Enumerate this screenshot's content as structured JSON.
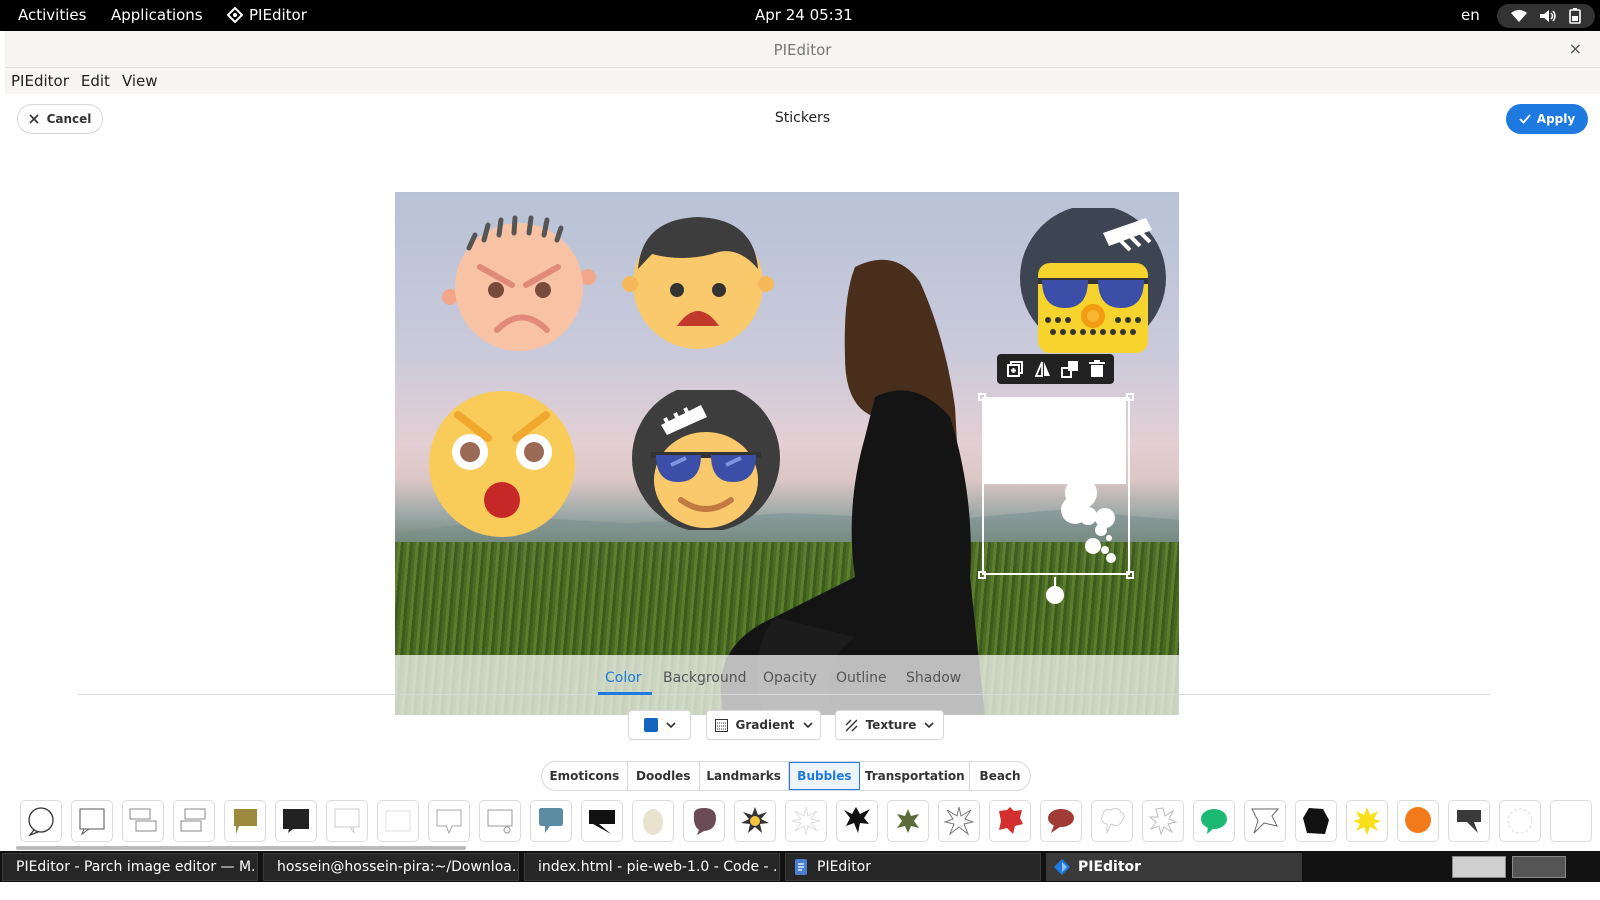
{
  "topbar": {
    "activities": "Activities",
    "applications": "Applications",
    "app_name": "PIEditor",
    "clock": "Apr 24  05:31",
    "lang": "en"
  },
  "window": {
    "title": "PIEditor",
    "close": "×",
    "menu": [
      "PIEditor",
      "Edit",
      "View"
    ]
  },
  "header": {
    "cancel_label": "Cancel",
    "title": "Stickers",
    "apply_label": "Apply"
  },
  "property_tabs": {
    "items": [
      "Color",
      "Background",
      "Opacity",
      "Outline",
      "Shadow"
    ],
    "active": "Color"
  },
  "controls": {
    "color_swatch": "#1565c0",
    "gradient_label": "Gradient",
    "texture_label": "Texture"
  },
  "categories": {
    "items": [
      "Emoticons",
      "Doodles",
      "Landmarks",
      "Bubbles",
      "Transportation",
      "Beach"
    ],
    "active": "Bubbles"
  },
  "taskbar": {
    "tasks": [
      "PIEditor - Parch image editor — M...",
      "hossein@hossein-pira:~/Downloa...",
      "index.html - pie-web-1.0 - Code - ...",
      "PIEditor",
      "PIEditor"
    ]
  },
  "colors": {
    "accent": "#1f7ae0",
    "topbar": "#000000",
    "taskbar": "#111111"
  }
}
